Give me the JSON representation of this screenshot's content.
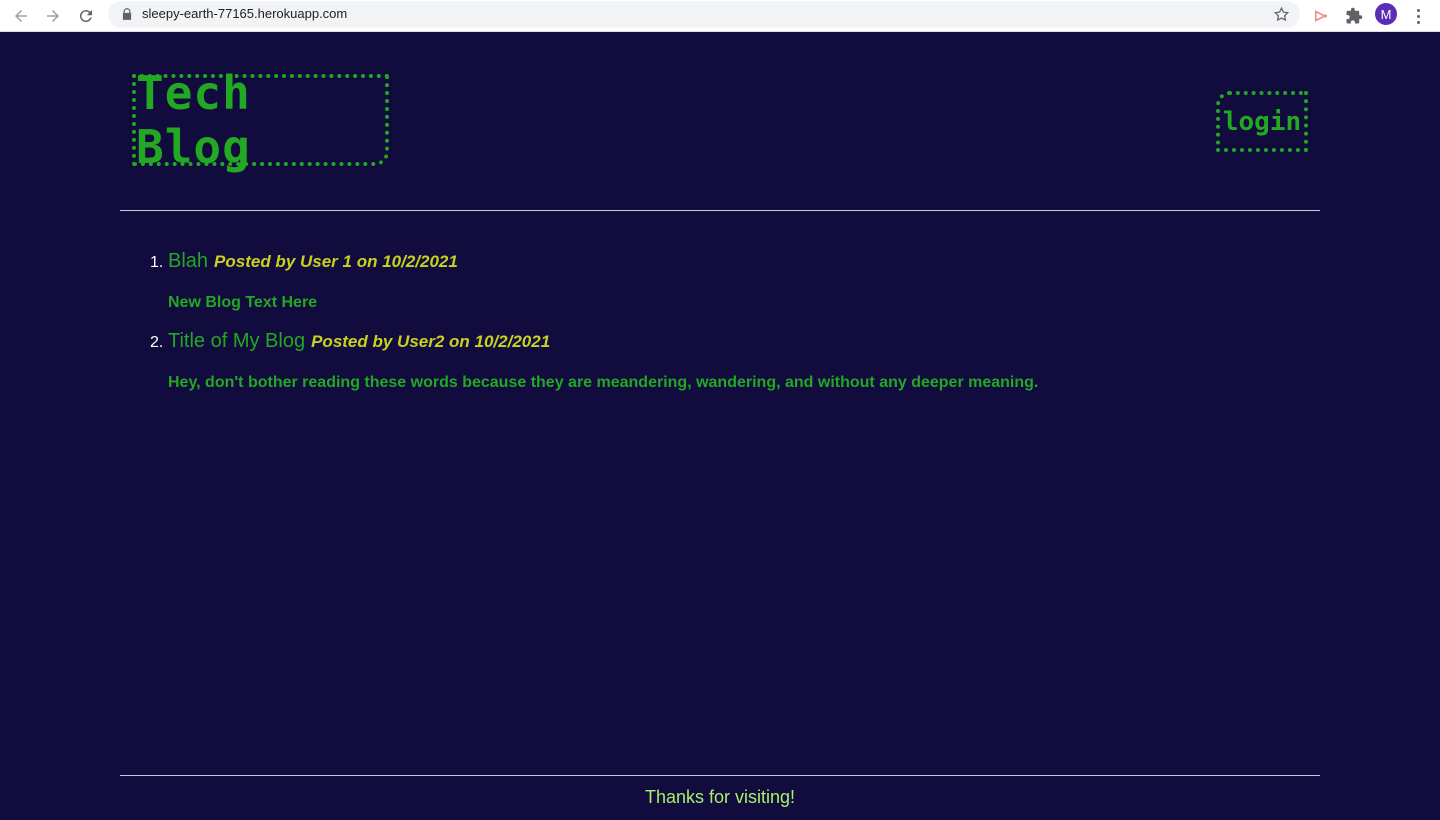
{
  "browser": {
    "url": "sleepy-earth-77165.herokuapp.com",
    "avatar_initial": "M"
  },
  "header": {
    "logo": "Tech Blog",
    "login_label": "login"
  },
  "posts": [
    {
      "number": "1.",
      "title": "Blah",
      "meta": "Posted by User 1 on 10/2/2021",
      "body": "New Blog Text Here"
    },
    {
      "number": "2.",
      "title": "Title of My Blog",
      "meta": "Posted by User2 on 10/2/2021",
      "body": "Hey, don't bother reading these words because they are meandering, wandering, and without any deeper meaning."
    }
  ],
  "footer": {
    "text": "Thanks for visiting!"
  },
  "colors": {
    "background": "#110b3e",
    "accent_green": "#22a822",
    "meta_yellow": "#c8d21e",
    "footer_green": "#a6f06a"
  }
}
